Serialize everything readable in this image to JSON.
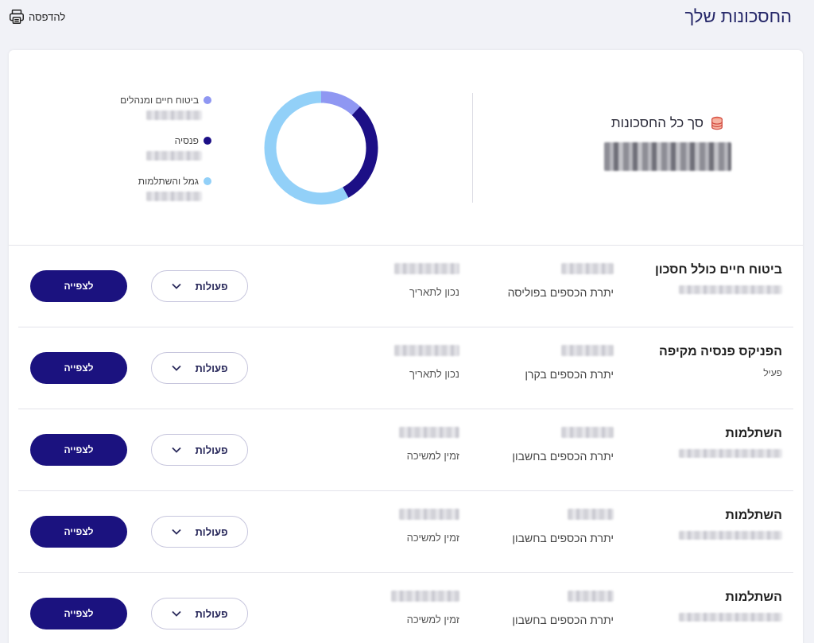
{
  "header": {
    "title": "החסכונות שלך",
    "print_label": "להדפסה"
  },
  "summary": {
    "total_title": "סך כל החסכונות",
    "legend": [
      {
        "label": "ביטוח חיים ומנהלים",
        "color": "#8f97f2"
      },
      {
        "label": "פנסיה",
        "color": "#1c0f86"
      },
      {
        "label": "גמל והשתלמות",
        "color": "#92d0f8"
      }
    ],
    "donut": {
      "segments": [
        {
          "label": "ביטוח חיים ומנהלים",
          "fraction": 0.12,
          "color": "#8f97f2"
        },
        {
          "label": "פנסיה",
          "fraction": 0.3,
          "color": "#1c0f86"
        },
        {
          "label": "גמל והשתלמות",
          "fraction": 0.58,
          "color": "#92d0f8"
        }
      ]
    }
  },
  "products": [
    {
      "name": "ביטוח חיים כולל חסכון",
      "status": "",
      "balance_label": "יתרת הכספים בפוליסה",
      "date_label": "נכון לתאריך",
      "actions_label": "פעולות",
      "view_label": "לצפייה"
    },
    {
      "name": "הפניקס פנסיה מקיפה",
      "status": "פעיל",
      "balance_label": "יתרת הכספים בקרן",
      "date_label": "נכון לתאריך",
      "actions_label": "פעולות",
      "view_label": "לצפייה"
    },
    {
      "name": "השתלמות",
      "status": "",
      "balance_label": "יתרת הכספים בחשבון",
      "date_label": "זמין למשיכה",
      "actions_label": "פעולות",
      "view_label": "לצפייה"
    },
    {
      "name": "השתלמות",
      "status": "",
      "balance_label": "יתרת הכספים בחשבון",
      "date_label": "זמין למשיכה",
      "actions_label": "פעולות",
      "view_label": "לצפייה"
    },
    {
      "name": "השתלמות",
      "status": "",
      "balance_label": "יתרת הכספים בחשבון",
      "date_label": "זמין למשיכה",
      "actions_label": "פעולות",
      "view_label": "לצפייה"
    }
  ]
}
